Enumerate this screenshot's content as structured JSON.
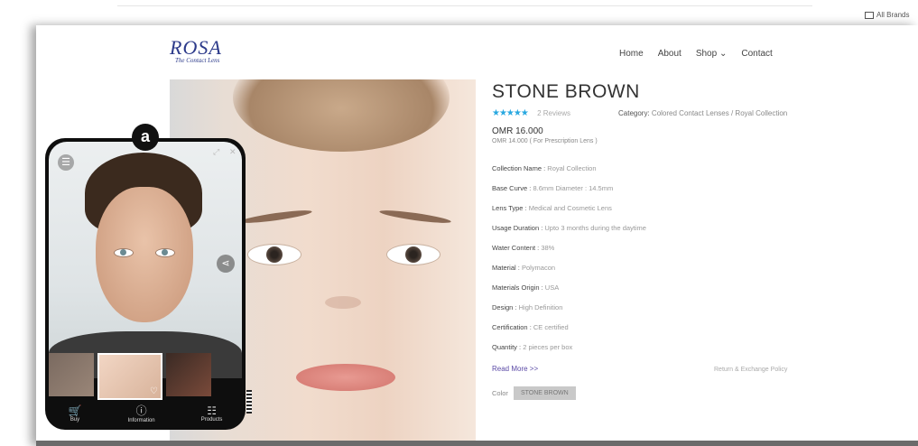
{
  "topbar": {
    "account_label": "All Brands"
  },
  "header": {
    "logo_text": "ROSA",
    "logo_tagline": "The Contact Lens",
    "nav": [
      "Home",
      "About",
      "Shop ⌄",
      "Contact"
    ]
  },
  "product": {
    "title": "STONE BROWN",
    "stars": "★★★★★",
    "reviews": "2 Reviews",
    "category_label": "Category:",
    "category_value": "Colored Contact Lenses / Royal Collection",
    "price": "OMR 16.000",
    "price_note": "OMR 14.000 ( For Prescription Lens )",
    "specs": [
      {
        "k": "Collection Name",
        "v": "Royal Collection"
      },
      {
        "k": "Base Curve",
        "v": "8.6mm Diameter : 14.5mm"
      },
      {
        "k": "Lens Type",
        "v": "Medical and Cosmetic Lens"
      },
      {
        "k": "Usage Duration",
        "v": "Upto 3 months during the daytime"
      },
      {
        "k": "Water Content",
        "v": "38%"
      },
      {
        "k": "Material",
        "v": "Polymacon"
      },
      {
        "k": "Materials Origin",
        "v": "USA"
      },
      {
        "k": "Design",
        "v": "High Definition"
      },
      {
        "k": "Certification",
        "v": "CE certified"
      },
      {
        "k": "Quantity",
        "v": "2 pieces per box"
      }
    ],
    "read_more": "Read More >>",
    "returns_link": "Return & Exchange Policy",
    "color_label": "Color",
    "color_value": "STONE BROWN"
  },
  "widget": {
    "badge": "a",
    "share_icon": "share-icon",
    "tabs": [
      {
        "icon": "cart-icon",
        "label": "Buy"
      },
      {
        "icon": "info-icon",
        "label": "Information"
      },
      {
        "icon": "grid-icon",
        "label": "Products"
      }
    ]
  }
}
